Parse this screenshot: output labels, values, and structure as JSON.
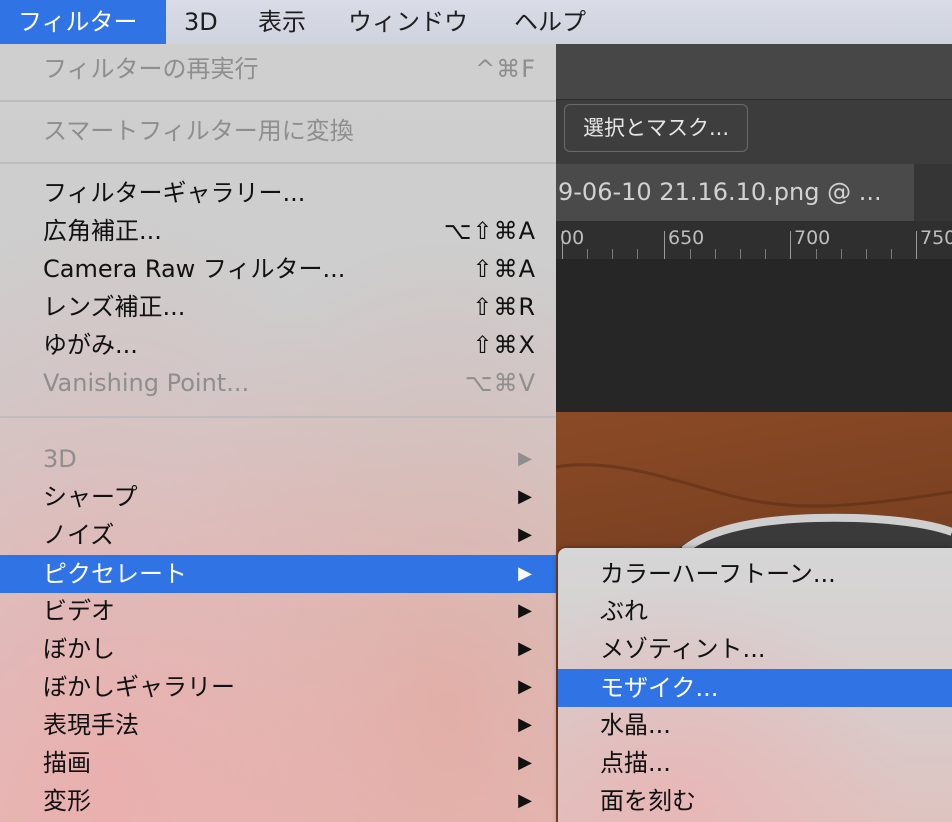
{
  "menubar": {
    "items": [
      "フィルター",
      "3D",
      "表示",
      "ウィンドウ",
      "ヘルプ"
    ]
  },
  "options_bar": {
    "select_mask_button": "選択とマスク..."
  },
  "document": {
    "tab_title": "9-06-10 21.16.10.png @ ...",
    "ruler_labels": [
      "00",
      "650",
      "700",
      "750"
    ]
  },
  "filter_menu": {
    "last_filter": {
      "label": "フィルターの再実行",
      "shortcut": "^⌘F"
    },
    "smart_filter": {
      "label": "スマートフィルター用に変換"
    },
    "gallery": {
      "label": "フィルターギャラリー..."
    },
    "adaptive_wide": {
      "label": "広角補正...",
      "shortcut": "⌥⇧⌘A"
    },
    "camera_raw": {
      "label": "Camera Raw フィルター...",
      "shortcut": "⇧⌘A"
    },
    "lens_correction": {
      "label": "レンズ補正...",
      "shortcut": "⇧⌘R"
    },
    "liquify": {
      "label": "ゆがみ...",
      "shortcut": "⇧⌘X"
    },
    "vanishing_point": {
      "label": "Vanishing Point...",
      "shortcut": "⌥⌘V"
    },
    "submenus": [
      {
        "label": "3D",
        "disabled": true
      },
      {
        "label": "シャープ"
      },
      {
        "label": "ノイズ"
      },
      {
        "label": "ピクセレート",
        "selected": true
      },
      {
        "label": "ビデオ"
      },
      {
        "label": "ぼかし"
      },
      {
        "label": "ぼかしギャラリー"
      },
      {
        "label": "表現手法"
      },
      {
        "label": "描画"
      },
      {
        "label": "変形"
      }
    ],
    "arrow": "▶"
  },
  "pixelate_submenu": {
    "items": [
      {
        "label": "カラーハーフトーン..."
      },
      {
        "label": "ぶれ"
      },
      {
        "label": "メゾティント..."
      },
      {
        "label": "モザイク...",
        "selected": true
      },
      {
        "label": "水晶..."
      },
      {
        "label": "点描..."
      },
      {
        "label": "面を刻む"
      }
    ]
  },
  "colors": {
    "highlight": "#2f73e4",
    "menubar": "#d6d9e3",
    "disabled_text": "#8e8e8e"
  }
}
